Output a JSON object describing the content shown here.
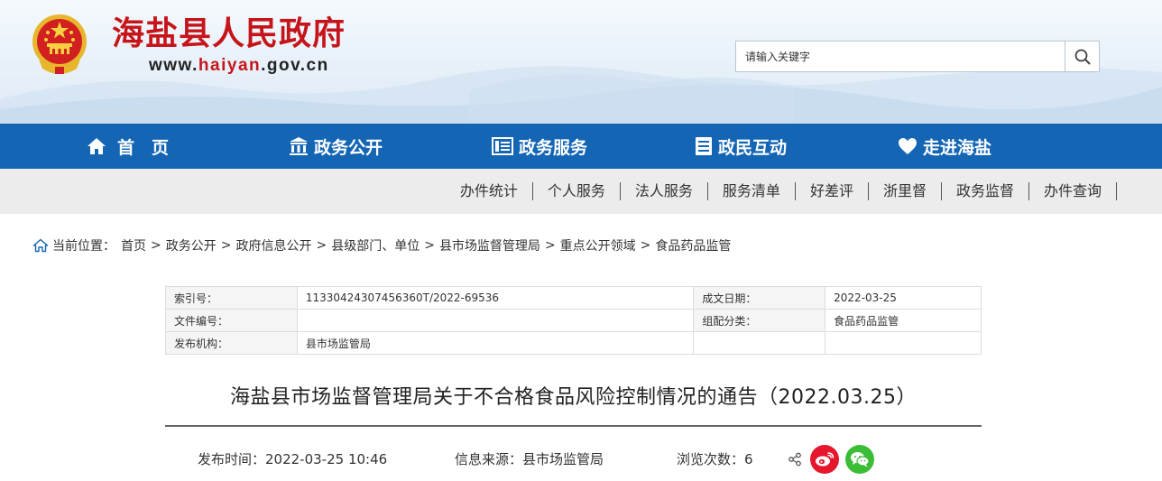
{
  "header": {
    "site_title": "海盐县人民政府",
    "url_prefix": "www.",
    "url_highlight": "haiyan",
    "url_suffix": ".gov.cn"
  },
  "search": {
    "placeholder": "请输入关键字",
    "icon": "search-icon"
  },
  "main_nav": [
    {
      "label": "首　页",
      "icon": "home-icon"
    },
    {
      "label": "政务公开",
      "icon": "building-icon"
    },
    {
      "label": "政务服务",
      "icon": "list-icon"
    },
    {
      "label": "政民互动",
      "icon": "document-icon"
    },
    {
      "label": "走进海盐",
      "icon": "heart-icon"
    }
  ],
  "sub_nav": [
    "办件统计",
    "个人服务",
    "法人服务",
    "服务清单",
    "好差评",
    "浙里督",
    "政务监督",
    "办件查询"
  ],
  "breadcrumb": {
    "label": "当前位置：",
    "items": [
      "首页",
      "政务公开",
      "政府信息公开",
      "县级部门、单位",
      "县市场监督管理局",
      "重点公开领域",
      "食品药品监管"
    ],
    "separator": ">"
  },
  "meta": {
    "index_label": "索引号：",
    "index_value": "11330424307456360T/2022-69536",
    "date_label": "成文日期：",
    "date_value": "2022-03-25",
    "doc_no_label": "文件编号：",
    "doc_no_value": "",
    "category_label": "组配分类：",
    "category_value": "食品药品监管",
    "publisher_label": "发布机构：",
    "publisher_value": "县市场监管局"
  },
  "article": {
    "title": "海盐县市场监督管理局关于不合格食品风险控制情况的通告（2022.03.25）",
    "publish_time": "发布时间：2022-03-25 10:46",
    "source": "信息来源：县市场监管局",
    "views": "浏览次数：6"
  },
  "colors": {
    "brand_red": "#c6151a",
    "nav_blue": "#1466b5",
    "weibo_red": "#e6162d",
    "wechat_green": "#3bbd36"
  }
}
